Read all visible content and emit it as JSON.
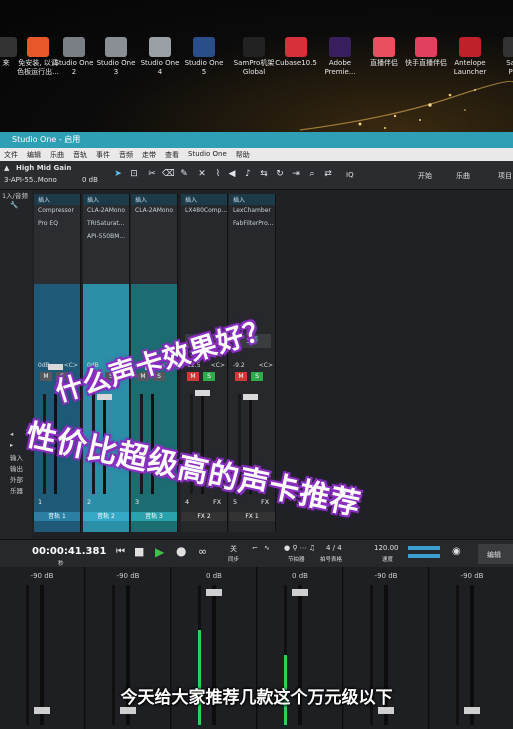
{
  "desktop": {
    "icons": [
      {
        "label": "来",
        "color": "#333"
      },
      {
        "label": "免安装, 以调\n色板运行出...",
        "color": "#e6582a"
      },
      {
        "label": "Studio One\n2",
        "color": "#7a7f86"
      },
      {
        "label": "Studio One\n3",
        "color": "#8a8f96"
      },
      {
        "label": "Studio One\n4",
        "color": "#9aa0a6"
      },
      {
        "label": "Studio One\n5",
        "color": "#2a4e8a"
      },
      {
        "label": "SamPro机架\nGlobal",
        "color": "#222"
      },
      {
        "label": "Cubase10.5",
        "color": "#d8303a"
      },
      {
        "label": "Adobe\nPremie...",
        "color": "#3a1f5e"
      },
      {
        "label": "直播伴侣",
        "color": "#e85060"
      },
      {
        "label": "快手直播伴侣",
        "color": "#e34060"
      },
      {
        "label": "Antelope\nLauncher",
        "color": "#c0202a"
      },
      {
        "label": "Sam\nPro",
        "color": "#333"
      }
    ]
  },
  "app": {
    "title": "Studio One - 启用",
    "menu": [
      "文件",
      "编辑",
      "乐曲",
      "音轨",
      "事件",
      "音频",
      "走带",
      "查看",
      "Studio One",
      "帮助"
    ],
    "toolbar": {
      "preset": "High Mid Gain",
      "device": "3-API-55..Mono",
      "gain": "0 dB",
      "iq": "IQ",
      "tabs": [
        "开始",
        "乐曲",
        "项目"
      ]
    },
    "left_labels": [
      "1入/音频",
      "",
      "",
      "",
      "",
      "",
      "",
      "",
      "",
      "",
      "",
      "",
      "",
      "",
      "",
      "",
      "",
      "",
      "",
      "",
      "",
      "",
      "",
      "",
      "",
      "",
      "",
      "输入",
      "输出",
      "外部",
      "乐器",
      "",
      ""
    ],
    "strips": [
      {
        "insert_hdr": "插入",
        "inserts": [
          "Compressor",
          "Pro EQ"
        ],
        "vol": "0dB",
        "pan": "<C>",
        "num": "1",
        "name": "音轨 1",
        "color": "#1e5a78",
        "name_bg": "#2a7fa3"
      },
      {
        "insert_hdr": "插入",
        "inserts": [
          "CLA-2AMono",
          "TRISaturat...",
          "API-550BM..."
        ],
        "vol": "0dB",
        "pan": "<C>",
        "num": "2",
        "name": "音轨 2",
        "color": "#2b8fa8",
        "name_bg": "#35a9c8"
      },
      {
        "insert_hdr": "插入",
        "inserts": [
          "CLA-2AMono"
        ],
        "vol": "0dB",
        "pan": "<C>",
        "num": "3",
        "name": "音轨 3",
        "color": "#1c6d72",
        "name_bg": "#2aa2ab"
      },
      {
        "insert_hdr": "插入",
        "inserts": [
          "LX480Comp..."
        ],
        "vol": "-12.5",
        "pan": "<C>",
        "num": "4",
        "name": "FX 2",
        "color": "#2b2d31",
        "name_bg": "#333",
        "bus": "主要"
      },
      {
        "insert_hdr": "插入",
        "inserts": [
          "LexChamber",
          "FabFilterPro..."
        ],
        "vol": "-9.2",
        "pan": "<C>",
        "num": "5",
        "name": "FX 1",
        "color": "#2b2d31",
        "name_bg": "#333",
        "bus": "主要"
      }
    ],
    "fx_label": "FX",
    "transport": {
      "time": "00:00:41.381",
      "time_unit": "秒",
      "sync": "关",
      "sync_label": "同步",
      "metronome": "节拍器",
      "signature": "4 / 4",
      "sig_label": "拍号表格",
      "tempo": "120.00",
      "tempo_label": "速度",
      "edit": "编辑"
    },
    "bottom_channels": [
      "-90 dB",
      "-90 dB",
      "0 dB",
      "0 dB",
      "-90 dB",
      "-90 dB"
    ]
  },
  "overlay": {
    "line1": "什么声卡效果好？",
    "line2": "性价比超级高的声卡推荐",
    "subtitle": "今天给大家推荐几款这个万元级以下"
  },
  "colors": {
    "titlebar": "#2f9fb5",
    "accent_blue": "#2a7fa3",
    "play_green": "#3ec24a",
    "text_shadow": "#8a2ec1"
  }
}
